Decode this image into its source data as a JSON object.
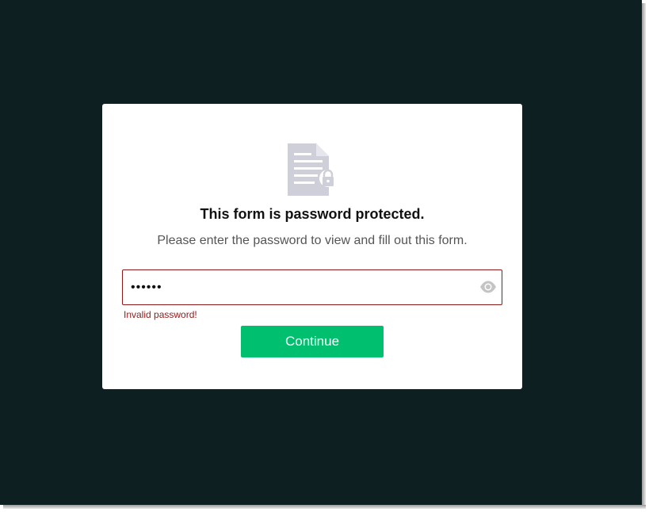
{
  "modal": {
    "icon": "locked-document-icon",
    "title": "This form is password protected.",
    "subtitle": "Please enter the password to view and fill out this form.",
    "password": {
      "value": "123456",
      "placeholder": "",
      "toggle_icon": "eye-icon",
      "error": "Invalid password!"
    },
    "continue_label": "Continue"
  },
  "colors": {
    "backdrop": "#0e1f22",
    "card": "#ffffff",
    "accent": "#00bf6f",
    "error": "#8e1b1b",
    "icon": "#cfcfd9"
  }
}
